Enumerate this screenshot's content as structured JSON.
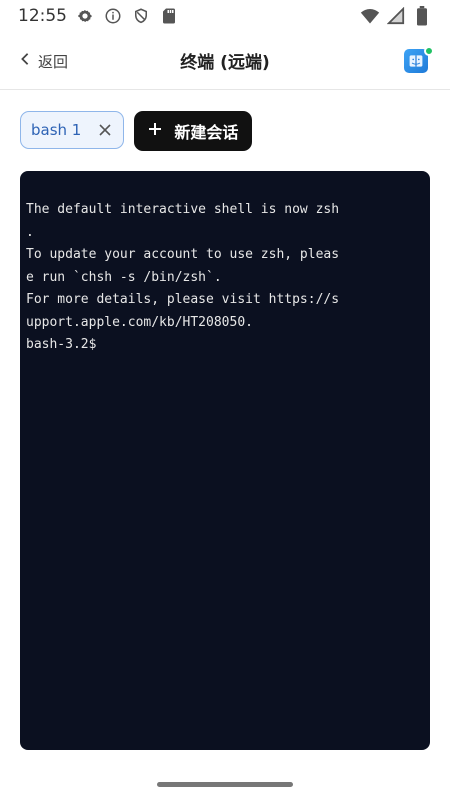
{
  "status_bar": {
    "time": "12:55",
    "left_icons": [
      "gear-icon",
      "info-icon",
      "shield-icon",
      "sd-card-icon"
    ],
    "right_icons": [
      "wifi-icon",
      "cell-signal-icon",
      "battery-icon"
    ]
  },
  "header": {
    "back_label": "返回",
    "title": "终端 (远端)",
    "status_dot_color": "#21c164"
  },
  "sessions": {
    "tabs": [
      {
        "label": "bash 1"
      }
    ],
    "new_session_label": "新建会话"
  },
  "terminal": {
    "lines": [
      "The default interactive shell is now zsh",
      ".",
      "To update your account to use zsh, pleas",
      "e run `chsh -s /bin/zsh`.",
      "For more details, please visit https://s",
      "upport.apple.com/kb/HT208050.",
      "bash-3.2$"
    ]
  }
}
